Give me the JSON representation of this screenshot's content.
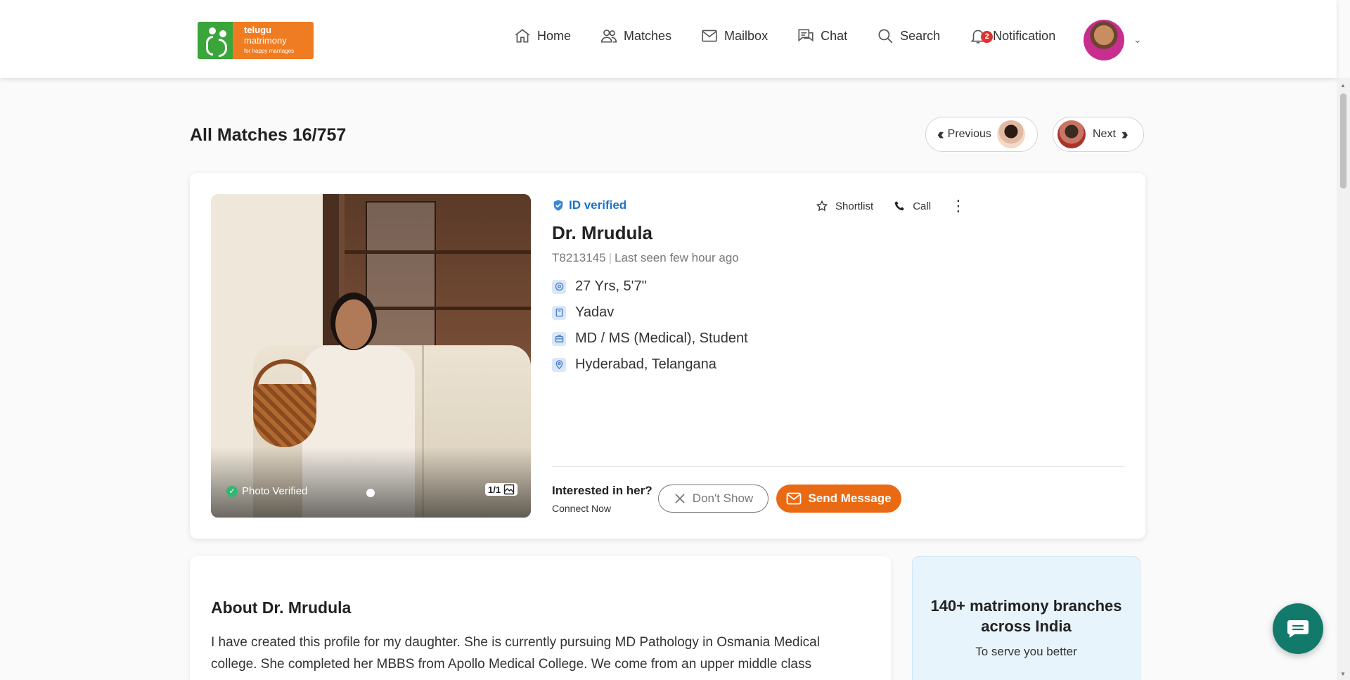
{
  "logo": {
    "line1": "telugu",
    "line2": "matrimony",
    "tagline": "for happy marriages"
  },
  "nav": {
    "items": [
      {
        "label": "Home",
        "icon": "home-icon"
      },
      {
        "label": "Matches",
        "icon": "users-icon"
      },
      {
        "label": "Mailbox",
        "icon": "mail-icon"
      },
      {
        "label": "Chat",
        "icon": "chat-icon"
      },
      {
        "label": "Search",
        "icon": "search-icon"
      },
      {
        "label": "Notification",
        "icon": "bell-icon"
      }
    ],
    "notification_count": "2"
  },
  "page": {
    "title": "All Matches 16/757",
    "previous_label": "Previous",
    "next_label": "Next"
  },
  "profile": {
    "id_verified": "ID verified",
    "name": "Dr. Mrudula",
    "profile_id": "T8213145",
    "last_seen": "Last seen few hour ago",
    "facts": [
      {
        "icon": "age-height-icon",
        "text": "27 Yrs, 5'7\""
      },
      {
        "icon": "community-icon",
        "text": "Yadav"
      },
      {
        "icon": "education-icon",
        "text": "MD / MS (Medical), Student"
      },
      {
        "icon": "location-icon",
        "text": "Hyderabad, Telangana"
      }
    ],
    "photo_verified": "Photo Verified",
    "photo_count": "1/1",
    "shortlist_label": "Shortlist",
    "call_label": "Call",
    "interest_question": "Interested in her?",
    "interest_sub": "Connect Now",
    "dont_show_label": "Don't Show",
    "send_message_label": "Send Message"
  },
  "about": {
    "title": "About Dr. Mrudula",
    "text": "I have created this profile for my daughter. She is currently pursuing MD Pathology in Osmania Medical college. She completed her MBBS from Apollo Medical College. We come from an upper middle class nuclear family with traditional values, currently settled in Hyderabad."
  },
  "branches": {
    "title": "140+ matrimony branches across India",
    "subtitle": "To serve you better"
  },
  "colors": {
    "brand_orange": "#ea6a14",
    "brand_green": "#3aa53a",
    "verified_blue": "#1a73c9",
    "chat_fab": "#127a6a"
  }
}
